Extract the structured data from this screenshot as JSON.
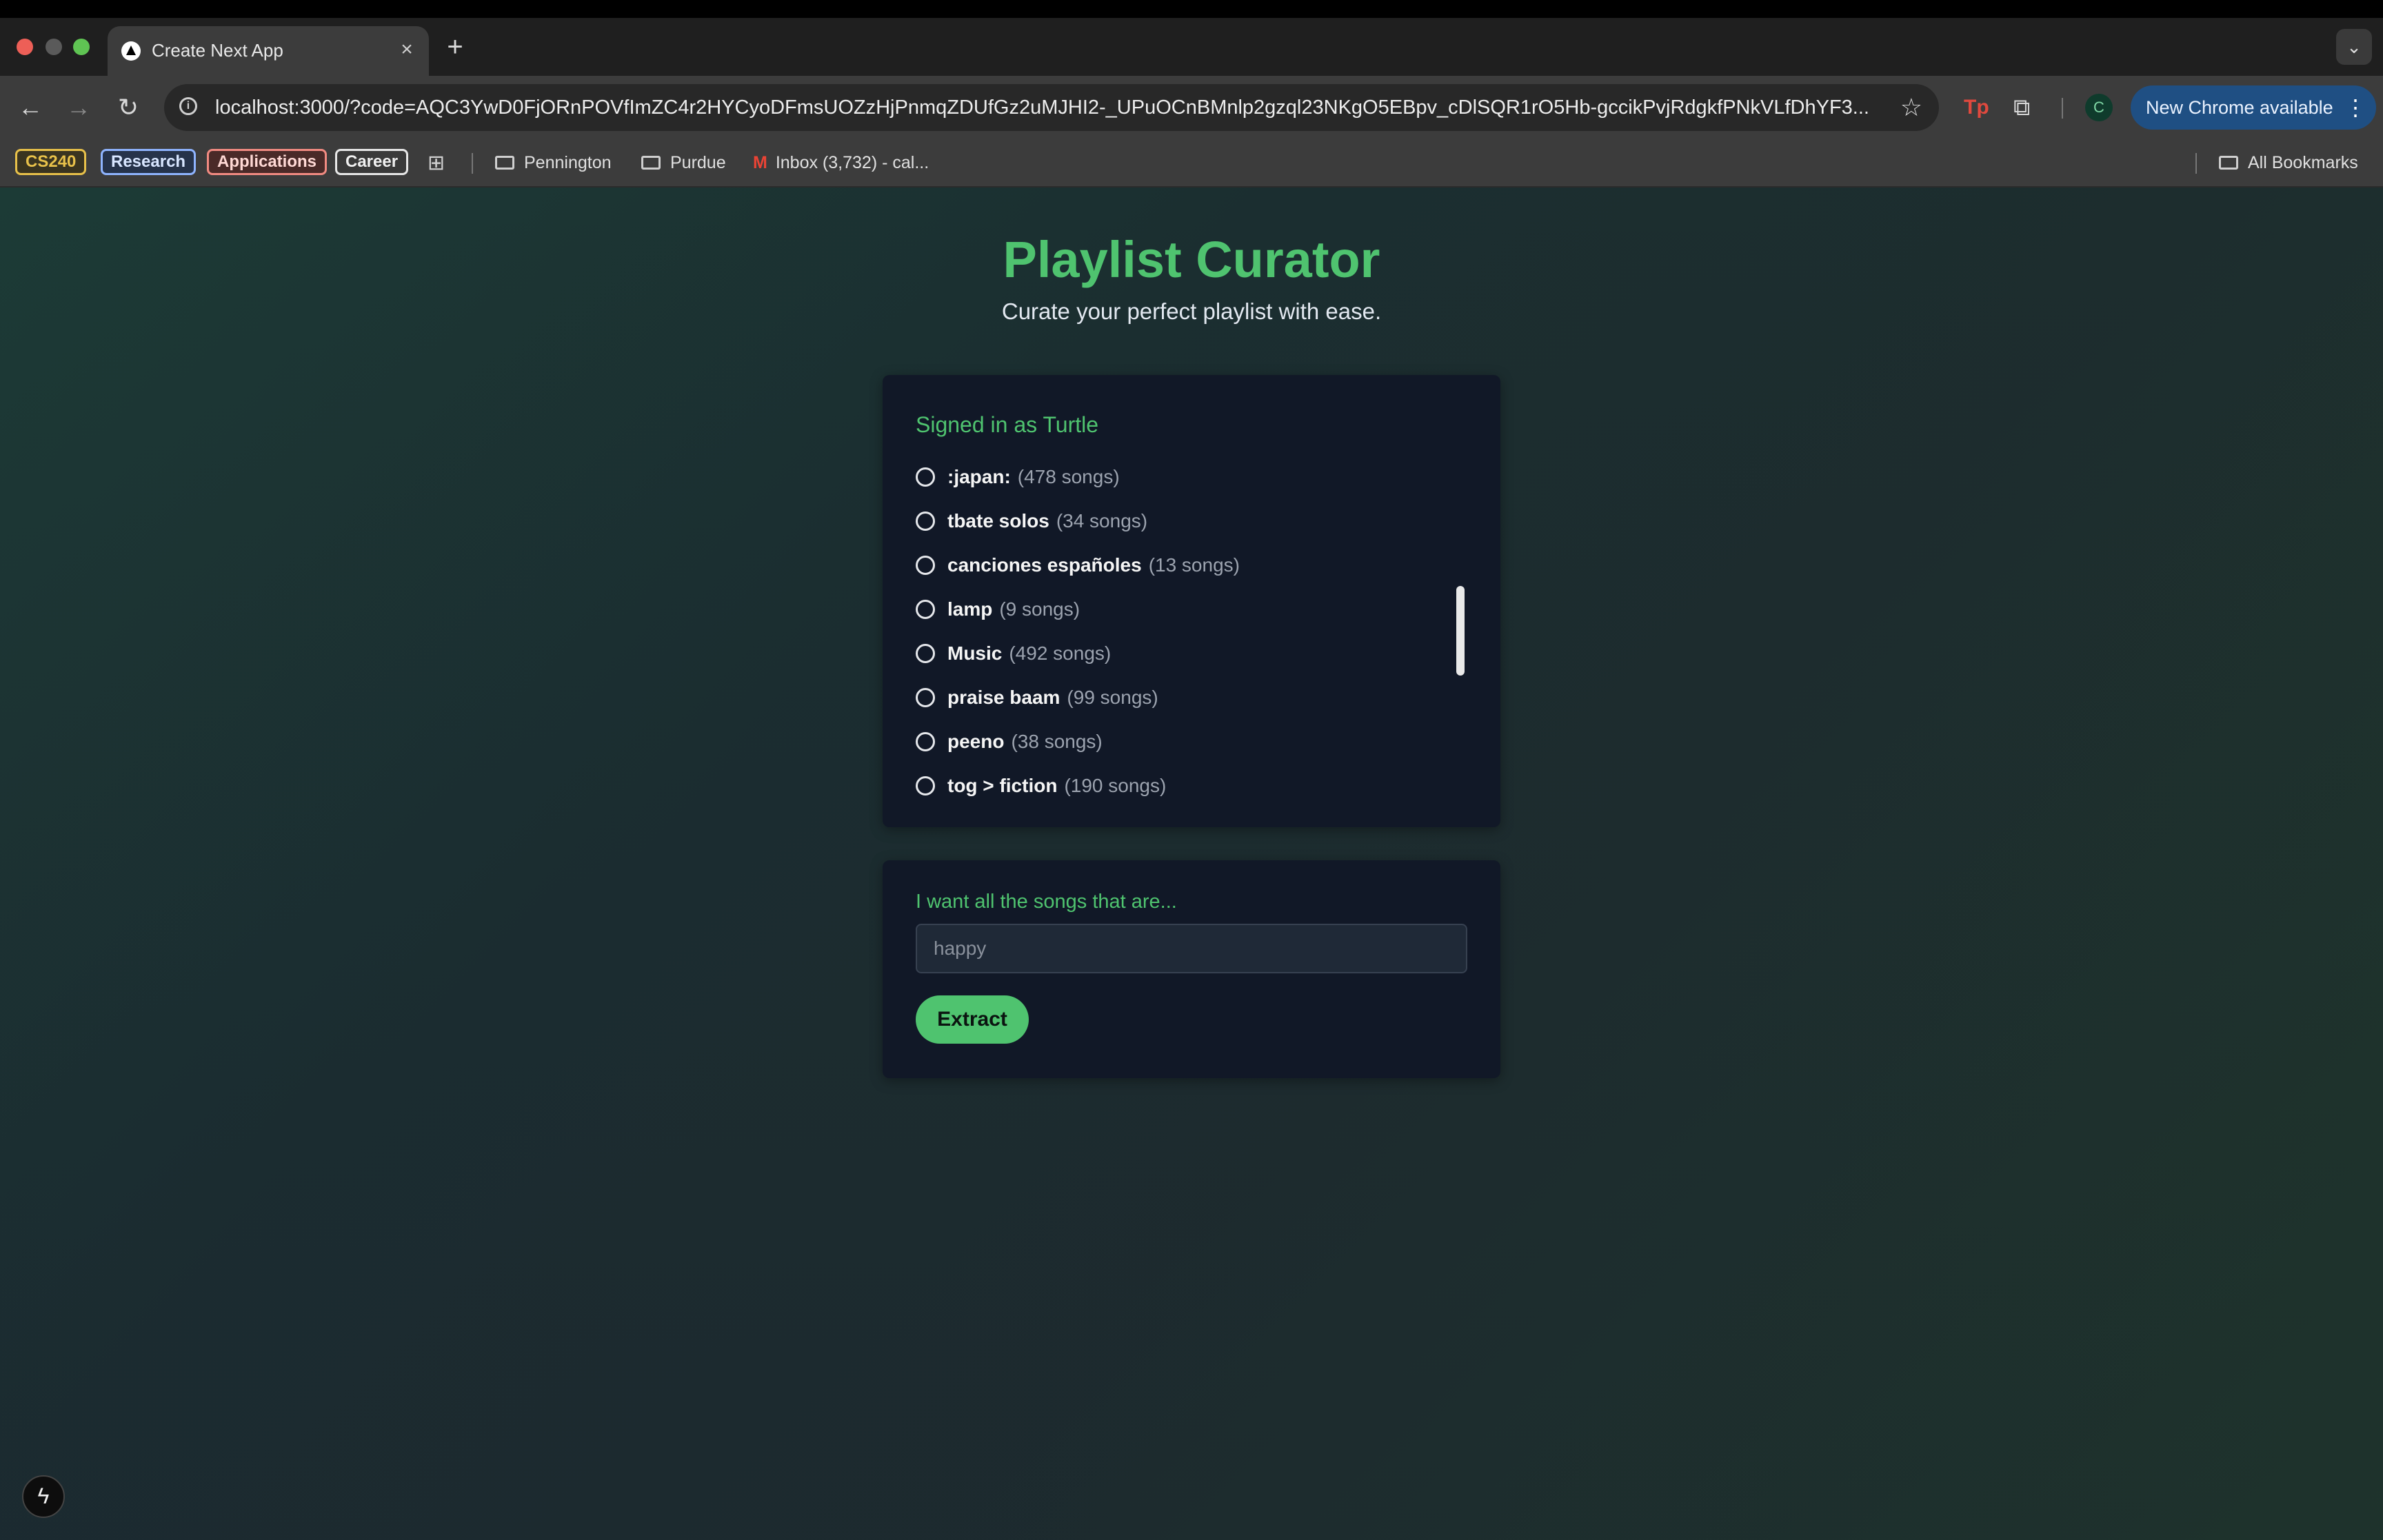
{
  "browser": {
    "tab": {
      "title": "Create Next App",
      "close_glyph": "×"
    },
    "new_tab_glyph": "+",
    "tab_search_glyph": "⌄",
    "nav": {
      "back_glyph": "←",
      "forward_glyph": "→",
      "reload_glyph": "↻"
    },
    "url": "localhost:3000/?code=AQC3YwD0FjORnPOVfImZC4r2HYCyoDFmsUOZzHjPnmqZDUfGz2uMJHI2-_UPuOCnBMnlp2gzql23NKgO5EBpv_cDlSQR1rO5Hb-gccikPvjRdgkfPNkVLfDhYF3...",
    "info_glyph": "i",
    "star_glyph": "☆",
    "tp_label": "Tp",
    "extension_glyph": "⧉",
    "profile_initial": "C",
    "update": {
      "label": "New Chrome available",
      "menu_glyph": "⋮"
    },
    "bookmarks": {
      "chips": [
        {
          "label": "CS240",
          "color": "#e8c14a"
        },
        {
          "label": "Research",
          "color": "#8fb4ff"
        },
        {
          "label": "Applications",
          "color": "#f28b82"
        },
        {
          "label": "Career",
          "color": "#e8e8e8"
        }
      ],
      "apps_glyph": "⊞",
      "folders": [
        "Pennington",
        "Purdue"
      ],
      "gmail_glyph": "M",
      "gmail_label": "Inbox (3,732) - cal...",
      "all_bookmarks": "All Bookmarks"
    }
  },
  "app": {
    "title": "Playlist Curator",
    "subtitle": "Curate your perfect playlist with ease.",
    "signed_in": "Signed in as Turtle",
    "playlists": [
      {
        "name": ":japan:",
        "count": "(478 songs)"
      },
      {
        "name": "tbate solos",
        "count": "(34 songs)"
      },
      {
        "name": "canciones españoles",
        "count": "(13 songs)"
      },
      {
        "name": "lamp",
        "count": "(9 songs)"
      },
      {
        "name": "Music",
        "count": "(492 songs)"
      },
      {
        "name": "praise baam",
        "count": "(99 songs)"
      },
      {
        "name": "peeno",
        "count": "(38 songs)"
      },
      {
        "name": "tog > fiction",
        "count": "(190 songs)"
      }
    ],
    "prompt_label": "I want all the songs that are...",
    "input_placeholder": "happy",
    "extract_label": "Extract",
    "dev_indicator_glyph": "ϟ"
  },
  "colors": {
    "accent": "#4fc36f",
    "card_bg": "#111827",
    "update_pill": "#1f4f83"
  }
}
